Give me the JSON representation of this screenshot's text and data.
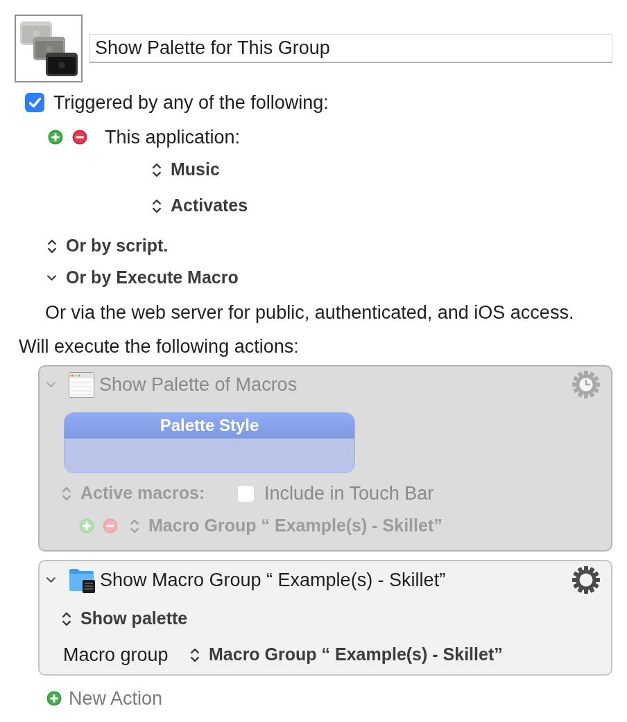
{
  "macro": {
    "name": "Show Palette for This Group"
  },
  "trigger_toggle": {
    "label": "Triggered by any of the following:",
    "checked": true
  },
  "triggers": [
    {
      "kind": "application",
      "label": "This application:",
      "popups": [
        "Music",
        "Activates"
      ]
    }
  ],
  "options": [
    {
      "label": "Or by script.",
      "expanded": false
    },
    {
      "label": "Or by Execute Macro",
      "expanded": true
    }
  ],
  "web_note": "Or via the web server for public, authenticated, and iOS access.",
  "actions_heading": "Will execute the following actions:",
  "actions": [
    {
      "kind": "show_palette",
      "title": "Show Palette of Macros",
      "enabled": false,
      "expanded": true,
      "timeout": true,
      "palette_style": "Palette Style",
      "active_macros": "Active macros:",
      "touch_bar": {
        "label": "Include in Touch Bar",
        "checked": false
      },
      "groups": [
        "Macro Group “ Example(s) - Skillet”"
      ]
    },
    {
      "kind": "show_macro_group",
      "title": "Show Macro Group “ Example(s) - Skillet”",
      "enabled": true,
      "expanded": true,
      "timeout": false,
      "mode": "Show palette",
      "field_label": "Macro group",
      "group": "Macro Group “ Example(s) - Skillet”"
    }
  ],
  "new_action": "New Action"
}
